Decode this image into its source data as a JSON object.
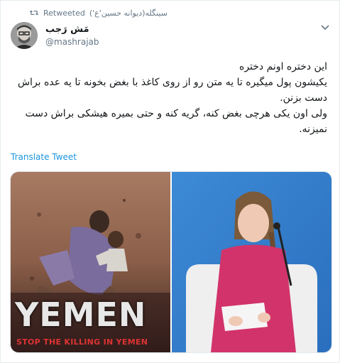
{
  "retweet": {
    "retweeter_name": "سینگله(دیوانه حسین'ع')",
    "label": "Retweeted"
  },
  "author": {
    "display_name": "مَش رَجب",
    "handle": "@mashrajab"
  },
  "tweet": {
    "lines": [
      "این دختره اونم دختره",
      "یکیشون پول میگیره تا یه متن رو از روی کاغذ با بغض بخونه تا یه عده براش دست بزنن.",
      "ولی اون یکی هرچی بغض کنه، گریه کنه و حتی بمیره هیشکی براش دست نمیزنه."
    ],
    "translate_label": "Translate Tweet"
  },
  "media": {
    "left_image": {
      "title": "YEMEN",
      "tagline": "STOP THE KILLING IN YEMEN"
    }
  },
  "colors": {
    "link": "#1b95e0",
    "secondary_text": "#657786",
    "primary_text": "#14171a",
    "border": "#e6ecf0"
  },
  "icons": {
    "retweet": "retweet-icon",
    "caret": "chevron-down-icon"
  }
}
